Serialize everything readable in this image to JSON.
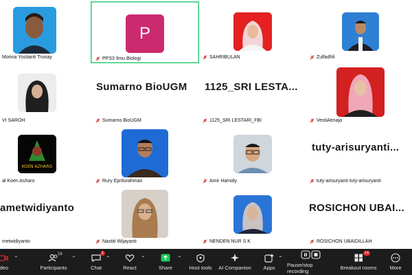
{
  "participants": [
    {
      "id": "morina",
      "name": "Morina Yostianti Trunay"
    },
    {
      "id": "pps3",
      "name": "PPS3 Ilmu Biologi",
      "initial": "P"
    },
    {
      "id": "sahribulan",
      "name": "SAHRIBULAN"
    },
    {
      "id": "zulfadhli",
      "name": "Zulfadhli"
    },
    {
      "id": "saroh",
      "name": "VI SAROH"
    },
    {
      "id": "sumarno",
      "name": "Sumarno BioUGM",
      "display": "Sumarno BioUGM"
    },
    {
      "id": "sri",
      "name": "1125_SRI LESTARI_FBI",
      "display": "1125_SRI  LESTA..."
    },
    {
      "id": "vesti",
      "name": "VestiAtmaja"
    },
    {
      "id": "koen",
      "name": "al Koen Asharo",
      "logo_text": "KOEN AZHARO"
    },
    {
      "id": "rury",
      "name": "Rury Eprilurahman"
    },
    {
      "id": "amir",
      "name": "Amir Hamidy"
    },
    {
      "id": "tuty",
      "name": "tuty-arisuryanti tuty-arisuryanti",
      "display": "tuty-arisuryanti..."
    },
    {
      "id": "slamet",
      "name": "metwidiyanto",
      "display": "ametwidiyanto"
    },
    {
      "id": "nastiti",
      "name": "Nastiti Wijayanti"
    },
    {
      "id": "nenden",
      "name": "NENDEN NUR S K"
    },
    {
      "id": "rosichon",
      "name": "ROSICHON UBAIDILLAH",
      "display": "ROSICHON  UBAI..."
    }
  ],
  "toolbar": {
    "video": "ideo",
    "participants": "Participants",
    "participants_count": "16",
    "chat": "Chat",
    "chat_badge": "1",
    "react": "React",
    "share": "Share",
    "host_tools": "Host tools",
    "ai_companion": "AI Companion",
    "apps": "Apps",
    "record": "Pause/stop recording",
    "breakout": "Breakout rooms",
    "breakout_badge": "14",
    "more": "More"
  },
  "colors": {
    "toolbar_bg": "#1c1c1c",
    "active_border": "#2ecc71",
    "avatar_bg": "#cc2a6f",
    "share_green": "#22c55e",
    "muted_red": "#e02a2a"
  }
}
